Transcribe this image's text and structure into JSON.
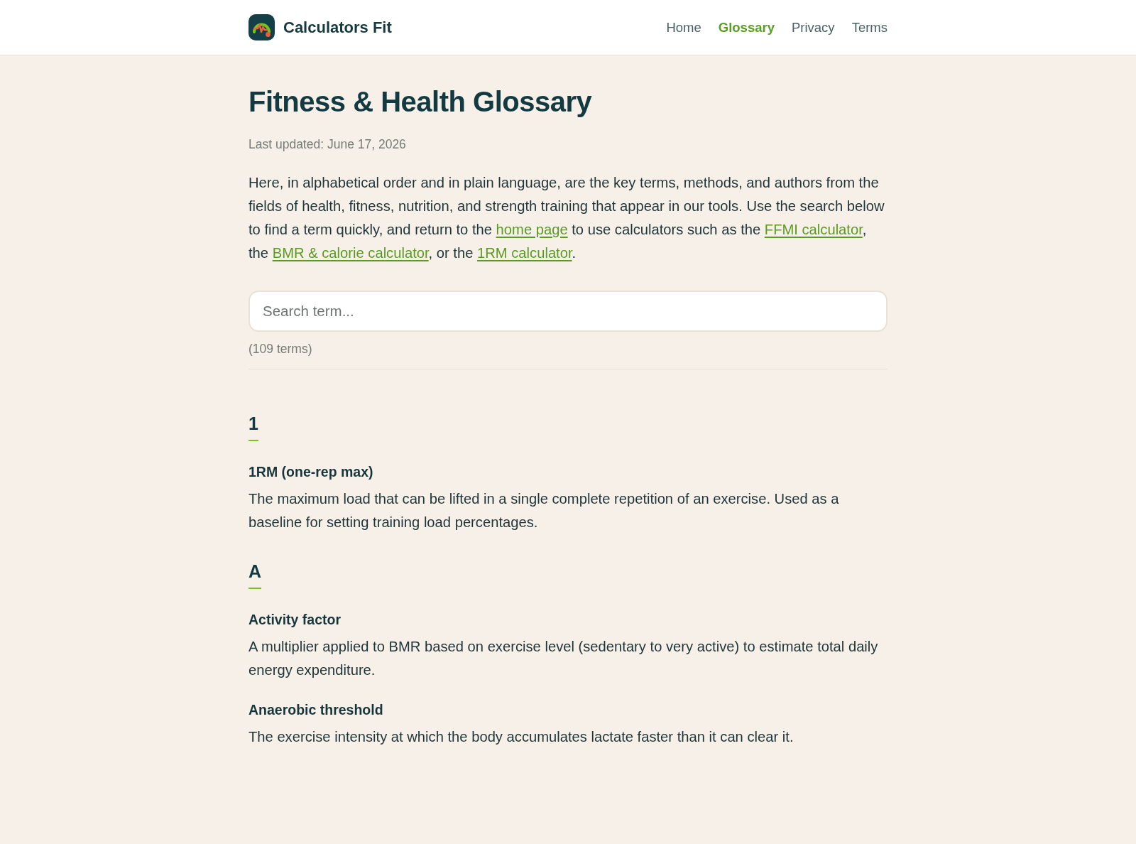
{
  "header": {
    "brand": "Calculators Fit",
    "nav": [
      {
        "label": "Home",
        "selected": false
      },
      {
        "label": "Glossary",
        "selected": true
      },
      {
        "label": "Privacy",
        "selected": false
      },
      {
        "label": "Terms",
        "selected": false
      }
    ]
  },
  "page": {
    "title": "Fitness & Health Glossary",
    "updated": "Last updated: June 17, 2026",
    "intro": [
      {
        "kind": "text",
        "text": "Here, in alphabetical order and in plain language, are the key terms, methods, and authors from the fields of health, fitness, nutrition, and strength training that appear in our tools. Use the search below to find a term quickly, and return to the "
      },
      {
        "kind": "link",
        "text": "home page"
      },
      {
        "kind": "text",
        "text": " to use calculators such as the "
      },
      {
        "kind": "link",
        "text": "FFMI calculator"
      },
      {
        "kind": "text",
        "text": ", the "
      },
      {
        "kind": "link",
        "text": "BMR & calorie calculator"
      },
      {
        "kind": "text",
        "text": ", or the "
      },
      {
        "kind": "link",
        "text": "1RM calculator"
      },
      {
        "kind": "text",
        "text": "."
      }
    ]
  },
  "search": {
    "placeholder": "Search term..."
  },
  "count": "(109 terms)",
  "sections": [
    {
      "letter": "1",
      "terms": [
        {
          "term": "1RM (one-rep max)",
          "definition": "The maximum load that can be lifted in a single complete repetition of an exercise. Used as a baseline for setting training load percentages."
        }
      ]
    },
    {
      "letter": "A",
      "terms": [
        {
          "term": "Activity factor",
          "definition": "A multiplier applied to BMR based on exercise level (sedentary to very active) to estimate total daily energy expenditure."
        },
        {
          "term": "Anaerobic threshold",
          "definition": "The exercise intensity at which the body accumulates lactate faster than it can clear it."
        }
      ]
    }
  ]
}
